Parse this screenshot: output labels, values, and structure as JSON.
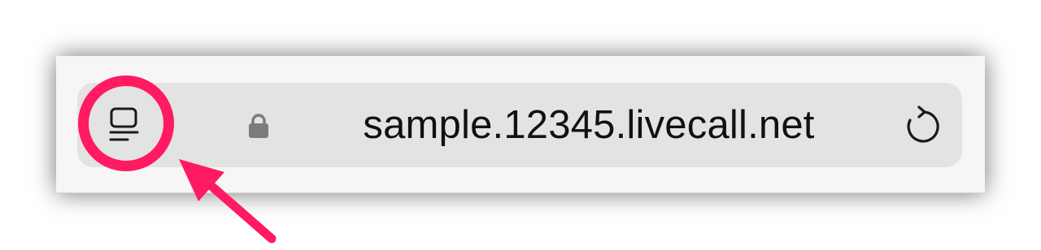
{
  "browser": {
    "url": "sample.12345.livecall.net",
    "icons": {
      "reader": "reader-view-icon",
      "lock": "lock-icon",
      "reload": "reload-icon"
    }
  },
  "annotation": {
    "color": "#ff1a62",
    "target": "reader-view-button"
  }
}
